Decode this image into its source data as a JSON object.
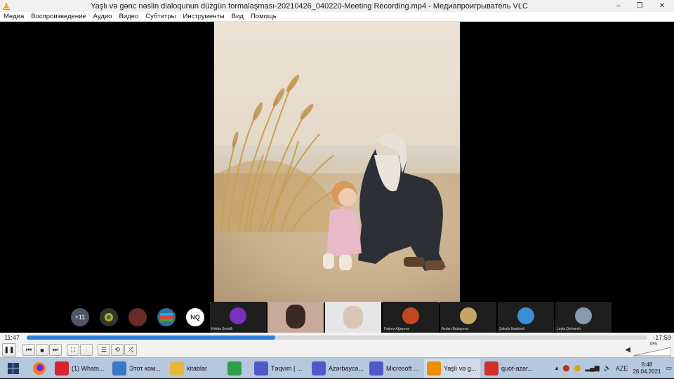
{
  "window": {
    "title": "Yaşlı və gənc nəslin dialoqunun düzgün formalaşması-20210426_040220-Meeting Recording.mp4 - Медиапроигрыватель VLC",
    "minimize": "–",
    "maximize": "❐",
    "close": "✕"
  },
  "menu": [
    "Медиа",
    "Воспроизведение",
    "Аудио",
    "Видео",
    "Субтитры",
    "Инструменты",
    "Вид",
    "Помощь"
  ],
  "participants": {
    "extra_count": "+11",
    "initials": "NQ",
    "tiles": [
      {
        "name": "Kelidə Seyidli"
      },
      {
        "name": ""
      },
      {
        "name": ""
      },
      {
        "name": "Fatimə Ağayeva"
      },
      {
        "name": "Aydan Babayeva"
      },
      {
        "name": "Şəkufə Ibrahimli"
      },
      {
        "name": "Leyla Qəhrəmlı"
      }
    ]
  },
  "player": {
    "elapsed": "11:47",
    "remaining": "-17:59",
    "progress": 0.4,
    "volume_label": "0%",
    "volume_level": 0
  },
  "controls": {
    "play_pause": "❚❚",
    "prev": "⏮",
    "stop": "■",
    "next": "⏭",
    "fullscreen": "⛶",
    "eq": "⫶",
    "playlist": "☰",
    "loop": "⟲",
    "shuffle": "⤮"
  },
  "taskbar": {
    "items": [
      {
        "label": "(1) Whats...",
        "icon": "opera-icon",
        "color": "#d9232e"
      },
      {
        "label": "Этот ком...",
        "icon": "computer-icon",
        "color": "#3a78c3"
      },
      {
        "label": "kitablar",
        "icon": "folder-icon",
        "color": "#e8b73c"
      },
      {
        "label": "",
        "icon": "chrome-icon",
        "color": "#2c9f4a"
      },
      {
        "label": "Təqvim | ...",
        "icon": "teams-icon",
        "color": "#5059c9"
      },
      {
        "label": "Azərbayca...",
        "icon": "teams-icon",
        "color": "#5059c9"
      },
      {
        "label": "Microsoft ...",
        "icon": "teams-icon",
        "color": "#5059c9"
      },
      {
        "label": "Yaşlı və g...",
        "icon": "vlc-icon",
        "color": "#f08c00"
      },
      {
        "label": "quot-azar...",
        "icon": "pdf-icon",
        "color": "#d0312d"
      }
    ],
    "language": "AZE",
    "time": "8:48",
    "date": "26.04.2021"
  }
}
